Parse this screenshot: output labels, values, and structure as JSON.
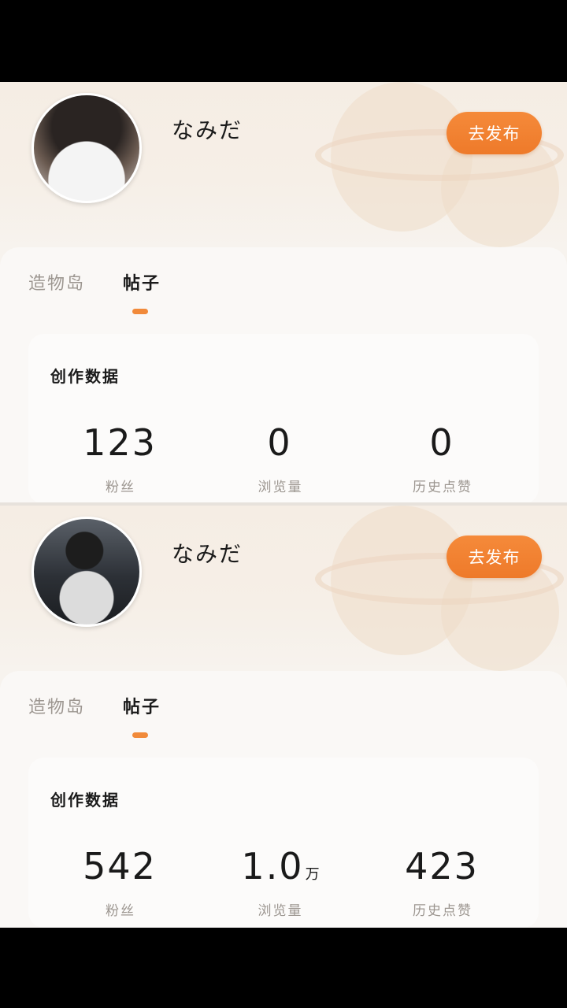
{
  "panels": [
    {
      "username": "なみだ",
      "publish_label": "去发布",
      "tabs": [
        "造物岛",
        "帖子"
      ],
      "stats_title": "创作数据",
      "stats": [
        {
          "value": "123",
          "unit": "",
          "label": "粉丝"
        },
        {
          "value": "0",
          "unit": "",
          "label": "浏览量"
        },
        {
          "value": "0",
          "unit": "",
          "label": "历史点赞"
        }
      ]
    },
    {
      "username": "なみだ",
      "publish_label": "去发布",
      "tabs": [
        "造物岛",
        "帖子"
      ],
      "stats_title": "创作数据",
      "stats": [
        {
          "value": "542",
          "unit": "",
          "label": "粉丝"
        },
        {
          "value": "1.0",
          "unit": "万",
          "label": "浏览量"
        },
        {
          "value": "423",
          "unit": "",
          "label": "历史点赞"
        }
      ]
    }
  ],
  "colors": {
    "accent": "#f18a3a",
    "muted_text": "#9c9690",
    "text": "#1a1a1a"
  }
}
